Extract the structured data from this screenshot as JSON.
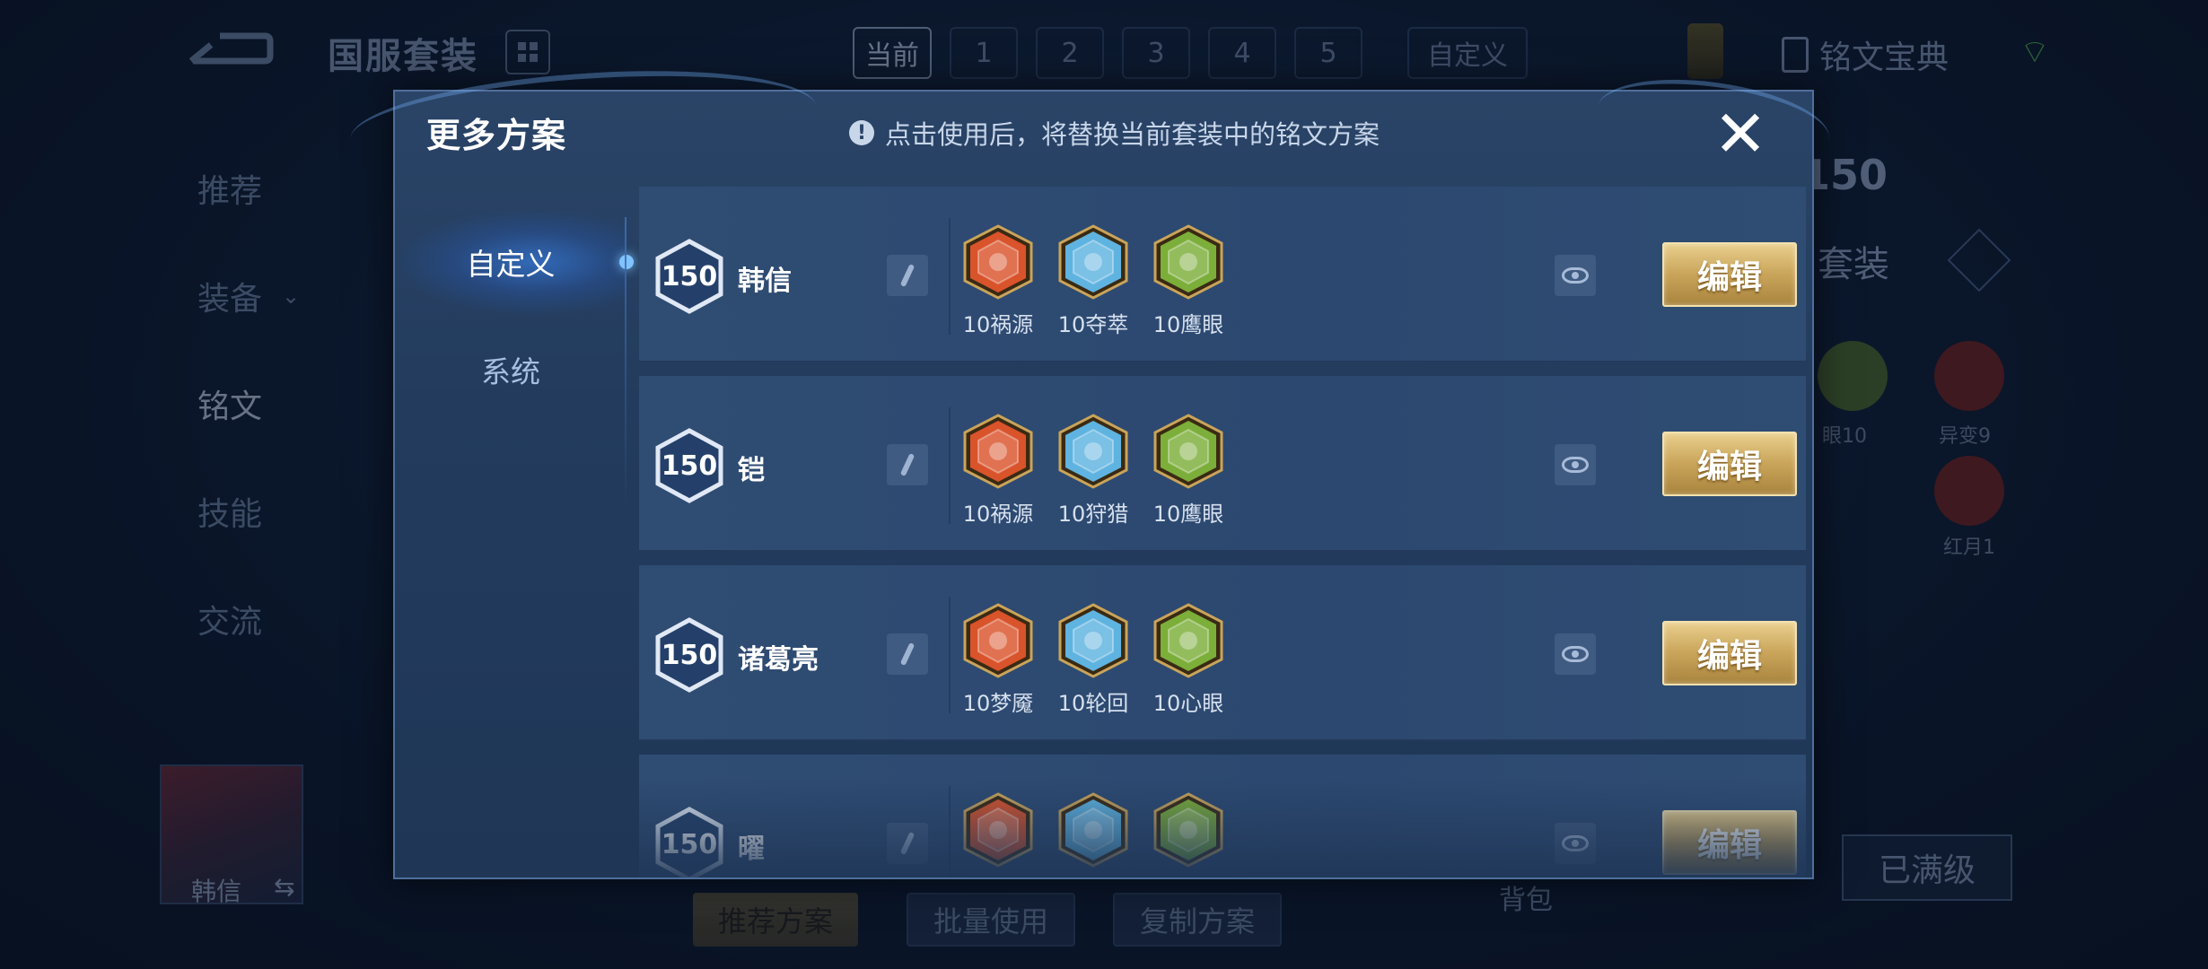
{
  "background": {
    "suite_title": "国服套装",
    "top_tabs": [
      "当前",
      "1",
      "2",
      "3",
      "4",
      "5"
    ],
    "custom_tab": "自定义",
    "inscription_book": "铭文宝典",
    "left_nav": [
      {
        "label": "推荐"
      },
      {
        "label": "装备"
      },
      {
        "label": "铭文"
      },
      {
        "label": "技能"
      },
      {
        "label": "交流"
      }
    ],
    "level_badge": "150",
    "suite_label": "套装",
    "bg_runes": [
      {
        "label": "眼10",
        "color": "#6a8a3a"
      },
      {
        "label": "异变9",
        "color": "#8a2a2a"
      },
      {
        "label": "红月1",
        "color": "#8a2a2a"
      }
    ],
    "full_level_button": "已满级",
    "bag_label": "背包",
    "bottom_buttons": [
      "推荐方案",
      "批量使用",
      "复制方案"
    ],
    "hero_name": "韩信",
    "swap_symbol": "⇆"
  },
  "modal": {
    "title": "更多方案",
    "hint_icon": "!",
    "hint": "点击使用后，将替换当前套装中的铭文方案",
    "close_symbol": "✕",
    "side_tabs": [
      {
        "label": "自定义",
        "active": true
      },
      {
        "label": "系统",
        "active": false
      }
    ],
    "edit_label": "编辑",
    "plans": [
      {
        "level": "150",
        "name": "韩信",
        "runes": [
          {
            "label": "10祸源",
            "color": "#d9532b",
            "icon": "red-rune-icon"
          },
          {
            "label": "10夺萃",
            "color": "#5fb3e0",
            "icon": "blue-rune-icon"
          },
          {
            "label": "10鹰眼",
            "color": "#7cae3a",
            "icon": "green-rune-icon"
          }
        ]
      },
      {
        "level": "150",
        "name": "铠",
        "runes": [
          {
            "label": "10祸源",
            "color": "#d9532b",
            "icon": "red-rune-icon"
          },
          {
            "label": "10狩猎",
            "color": "#5fb3e0",
            "icon": "blue-rune-icon"
          },
          {
            "label": "10鹰眼",
            "color": "#7cae3a",
            "icon": "green-rune-icon"
          }
        ]
      },
      {
        "level": "150",
        "name": "诸葛亮",
        "runes": [
          {
            "label": "10梦魇",
            "color": "#d9532b",
            "icon": "red-rune-icon"
          },
          {
            "label": "10轮回",
            "color": "#5fb3e0",
            "icon": "blue-rune-icon"
          },
          {
            "label": "10心眼",
            "color": "#7cae3a",
            "icon": "green-rune-icon"
          }
        ]
      },
      {
        "level": "150",
        "name": "曜",
        "runes": [
          {
            "label": "",
            "color": "#d9532b",
            "icon": "red-rune-icon"
          },
          {
            "label": "",
            "color": "#5fb3e0",
            "icon": "blue-rune-icon"
          },
          {
            "label": "",
            "color": "#7cae3a",
            "icon": "green-rune-icon"
          }
        ]
      }
    ]
  }
}
